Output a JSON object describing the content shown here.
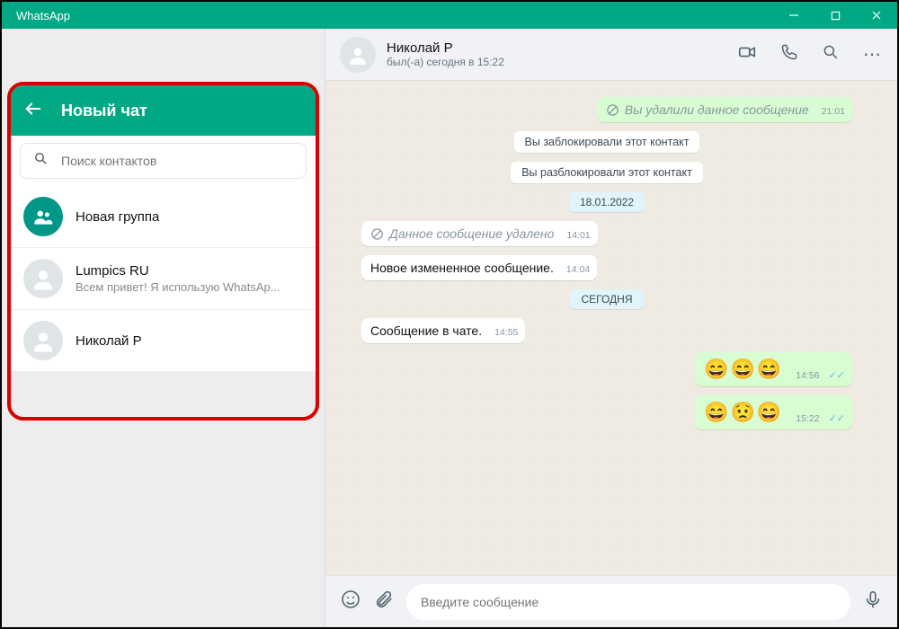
{
  "app": {
    "title": "WhatsApp"
  },
  "colors": {
    "accent": "#00a884",
    "bubble_out": "#d9fdd3",
    "chip": "#e1f3fb"
  },
  "newchat": {
    "title": "Новый чат",
    "search_placeholder": "Поиск контактов",
    "new_group": "Новая группа",
    "contacts": [
      {
        "name": "Lumpics RU",
        "status": "Всем привет! Я использую WhatsAp..."
      },
      {
        "name": "Николай Р",
        "status": ""
      }
    ]
  },
  "chat": {
    "header": {
      "name": "Николай Р",
      "last_seen": "был(-а) сегодня в 15:22"
    },
    "messages": [
      {
        "kind": "out_deleted",
        "text": "Вы удалили данное сообщение",
        "time": "21:01"
      },
      {
        "kind": "system",
        "text": "Вы заблокировали этот контакт"
      },
      {
        "kind": "system",
        "text": "Вы разблокировали этот контакт"
      },
      {
        "kind": "date",
        "text": "18.01.2022"
      },
      {
        "kind": "in_deleted",
        "text": "Данное сообщение удалено",
        "time": "14:01"
      },
      {
        "kind": "in",
        "text": "Новое измененное сообщение.",
        "time": "14:04"
      },
      {
        "kind": "date",
        "text": "СЕГОДНЯ"
      },
      {
        "kind": "in",
        "text": "Сообщение в чате.",
        "time": "14:55"
      },
      {
        "kind": "out_emoji",
        "text": "😄😄😄",
        "time": "14:56",
        "read": true
      },
      {
        "kind": "out_emoji",
        "text": "😄😟😄",
        "time": "15:22",
        "read": true
      }
    ],
    "composer_placeholder": "Введите сообщение"
  }
}
